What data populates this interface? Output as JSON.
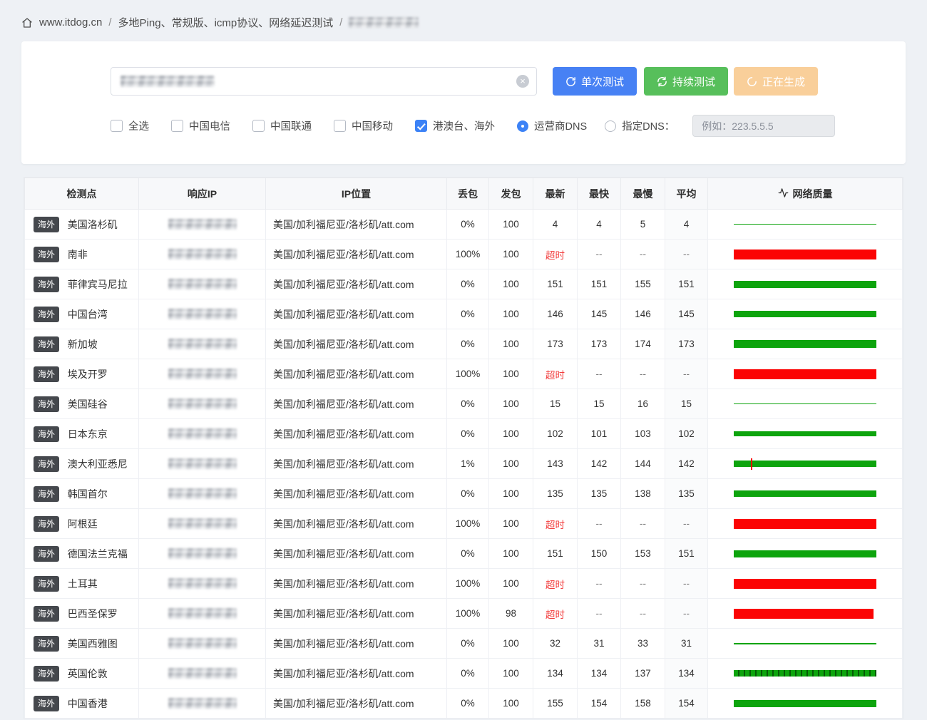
{
  "breadcrumb": {
    "site": "www.itdog.cn",
    "path": "多地Ping、常规版、icmp协议、网络延迟测试",
    "separator": "/"
  },
  "panel": {
    "input": {
      "value_redacted": true,
      "clear_icon": "×"
    },
    "buttons": {
      "single": "单次测试",
      "continuous": "持续测试",
      "generating": "正在生成"
    },
    "checkboxes": [
      {
        "label": "全选",
        "checked": false
      },
      {
        "label": "中国电信",
        "checked": false
      },
      {
        "label": "中国联通",
        "checked": false
      },
      {
        "label": "中国移动",
        "checked": false
      },
      {
        "label": "港澳台、海外",
        "checked": true
      }
    ],
    "radios": [
      {
        "label": "运营商DNS",
        "checked": true
      },
      {
        "label": "指定DNS：",
        "checked": false
      }
    ],
    "dns_placeholder": "例如：223.5.5.5"
  },
  "table": {
    "headers": [
      "检测点",
      "响应IP",
      "IP位置",
      "丢包",
      "发包",
      "最新",
      "最快",
      "最慢",
      "平均",
      "网络质量"
    ],
    "rows": [
      {
        "tag": "海外",
        "name": "美国洛杉矶",
        "location": "美国/加利福尼亚/洛杉矶/att.com",
        "loss": "0%",
        "sent": "100",
        "latest": "4",
        "fastest": "4",
        "slowest": "5",
        "avg": "4",
        "timeout": false,
        "bar": {
          "color": "green",
          "h": 1.5
        }
      },
      {
        "tag": "海外",
        "name": "南非",
        "location": "美国/加利福尼亚/洛杉矶/att.com",
        "loss": "100%",
        "sent": "100",
        "latest": "超时",
        "fastest": "--",
        "slowest": "--",
        "avg": "--",
        "timeout": true,
        "bar": {
          "color": "red",
          "h": 14
        }
      },
      {
        "tag": "海外",
        "name": "菲律宾马尼拉",
        "location": "美国/加利福尼亚/洛杉矶/att.com",
        "loss": "0%",
        "sent": "100",
        "latest": "151",
        "fastest": "151",
        "slowest": "155",
        "avg": "151",
        "timeout": false,
        "bar": {
          "color": "green",
          "h": 10
        }
      },
      {
        "tag": "海外",
        "name": "中国台湾",
        "location": "美国/加利福尼亚/洛杉矶/att.com",
        "loss": "0%",
        "sent": "100",
        "latest": "146",
        "fastest": "145",
        "slowest": "146",
        "avg": "145",
        "timeout": false,
        "bar": {
          "color": "green",
          "h": 9.5
        }
      },
      {
        "tag": "海外",
        "name": "新加坡",
        "location": "美国/加利福尼亚/洛杉矶/att.com",
        "loss": "0%",
        "sent": "100",
        "latest": "173",
        "fastest": "173",
        "slowest": "174",
        "avg": "173",
        "timeout": false,
        "bar": {
          "color": "green",
          "h": 11
        }
      },
      {
        "tag": "海外",
        "name": "埃及开罗",
        "location": "美国/加利福尼亚/洛杉矶/att.com",
        "loss": "100%",
        "sent": "100",
        "latest": "超时",
        "fastest": "--",
        "slowest": "--",
        "avg": "--",
        "timeout": true,
        "bar": {
          "color": "red",
          "h": 14
        }
      },
      {
        "tag": "海外",
        "name": "美国硅谷",
        "location": "美国/加利福尼亚/洛杉矶/att.com",
        "loss": "0%",
        "sent": "100",
        "latest": "15",
        "fastest": "15",
        "slowest": "16",
        "avg": "15",
        "timeout": false,
        "bar": {
          "color": "green",
          "h": 1.5
        }
      },
      {
        "tag": "海外",
        "name": "日本东京",
        "location": "美国/加利福尼亚/洛杉矶/att.com",
        "loss": "0%",
        "sent": "100",
        "latest": "102",
        "fastest": "101",
        "slowest": "103",
        "avg": "102",
        "timeout": false,
        "bar": {
          "color": "green",
          "h": 7
        }
      },
      {
        "tag": "海外",
        "name": "澳大利亚悉尼",
        "location": "美国/加利福尼亚/洛杉矶/att.com",
        "loss": "1%",
        "sent": "100",
        "latest": "143",
        "fastest": "142",
        "slowest": "144",
        "avg": "142",
        "timeout": false,
        "bar": {
          "color": "green",
          "h": 9.5,
          "spike": true
        }
      },
      {
        "tag": "海外",
        "name": "韩国首尔",
        "location": "美国/加利福尼亚/洛杉矶/att.com",
        "loss": "0%",
        "sent": "100",
        "latest": "135",
        "fastest": "135",
        "slowest": "138",
        "avg": "135",
        "timeout": false,
        "bar": {
          "color": "green",
          "h": 9
        }
      },
      {
        "tag": "海外",
        "name": "阿根廷",
        "location": "美国/加利福尼亚/洛杉矶/att.com",
        "loss": "100%",
        "sent": "100",
        "latest": "超时",
        "fastest": "--",
        "slowest": "--",
        "avg": "--",
        "timeout": true,
        "bar": {
          "color": "red",
          "h": 14
        }
      },
      {
        "tag": "海外",
        "name": "德国法兰克福",
        "location": "美国/加利福尼亚/洛杉矶/att.com",
        "loss": "0%",
        "sent": "100",
        "latest": "151",
        "fastest": "150",
        "slowest": "153",
        "avg": "151",
        "timeout": false,
        "bar": {
          "color": "green",
          "h": 10
        }
      },
      {
        "tag": "海外",
        "name": "土耳其",
        "location": "美国/加利福尼亚/洛杉矶/att.com",
        "loss": "100%",
        "sent": "100",
        "latest": "超时",
        "fastest": "--",
        "slowest": "--",
        "avg": "--",
        "timeout": true,
        "bar": {
          "color": "red",
          "h": 14
        }
      },
      {
        "tag": "海外",
        "name": "巴西圣保罗",
        "location": "美国/加利福尼亚/洛杉矶/att.com",
        "loss": "100%",
        "sent": "98",
        "latest": "超时",
        "fastest": "--",
        "slowest": "--",
        "avg": "--",
        "timeout": true,
        "bar": {
          "color": "red",
          "h": 14,
          "w": 98
        }
      },
      {
        "tag": "海外",
        "name": "美国西雅图",
        "location": "美国/加利福尼亚/洛杉矶/att.com",
        "loss": "0%",
        "sent": "100",
        "latest": "32",
        "fastest": "31",
        "slowest": "33",
        "avg": "31",
        "timeout": false,
        "bar": {
          "color": "green",
          "h": 2
        }
      },
      {
        "tag": "海外",
        "name": "英国伦敦",
        "location": "美国/加利福尼亚/洛杉矶/att.com",
        "loss": "0%",
        "sent": "100",
        "latest": "134",
        "fastest": "134",
        "slowest": "137",
        "avg": "134",
        "timeout": false,
        "bar": {
          "color": "green",
          "h": 9,
          "striped": true
        }
      },
      {
        "tag": "海外",
        "name": "中国香港",
        "location": "美国/加利福尼亚/洛杉矶/att.com",
        "loss": "0%",
        "sent": "100",
        "latest": "155",
        "fastest": "154",
        "slowest": "158",
        "avg": "154",
        "timeout": false,
        "bar": {
          "color": "green",
          "h": 10
        }
      }
    ]
  },
  "colors": {
    "primary_button": "#4781f4",
    "success_button": "#57bf5b",
    "warning_button": "#f9cf9a",
    "checkbox_checked": "#3c82f6",
    "timeout_text": "#f23d3d",
    "bar_green": "#0da40d",
    "bar_red": "#fb0404",
    "badge_bg": "#45484d"
  }
}
